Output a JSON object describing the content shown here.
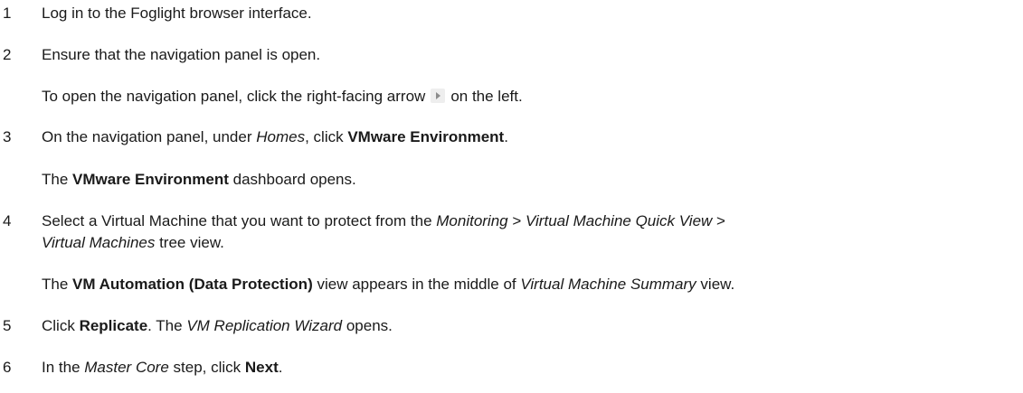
{
  "steps": [
    {
      "number": "1",
      "text": "Log in to the Foglight browser interface."
    },
    {
      "number": "2",
      "text": "Ensure that the navigation panel is open.",
      "note_prefix": "To open the navigation panel, click the right-facing arrow",
      "note_suffix": "on the left."
    },
    {
      "number": "3",
      "t1": "On the navigation panel, under ",
      "t2": "Homes",
      "t3": ", click ",
      "t4": "VMware Environment",
      "t5": ".",
      "result_b": "VMware Environment",
      "result_prefix": "The ",
      "result_suffix": " dashboard opens."
    },
    {
      "number": "4",
      "t1": "Select a Virtual Machine that you want to protect from the ",
      "t2": "Monitoring",
      "t3": " > ",
      "t4": "Virtual Machine Quick View",
      "t5": " >",
      "t6": "Virtual Machines",
      "t7": " tree view.",
      "r1": "The ",
      "r2": "VM Automation (Data Protection)",
      "r3": " view appears in the middle of ",
      "r4": "Virtual Machine Summary",
      "r5": " view."
    },
    {
      "number": "5",
      "t1": "Click ",
      "t2": "Replicate",
      "t3": ". The ",
      "t4": "VM Replication Wizard",
      "t5": " opens."
    },
    {
      "number": "6",
      "t1": "In the ",
      "t2": "Master Core",
      "t3": " step, click ",
      "t4": "Next",
      "t5": "."
    }
  ]
}
